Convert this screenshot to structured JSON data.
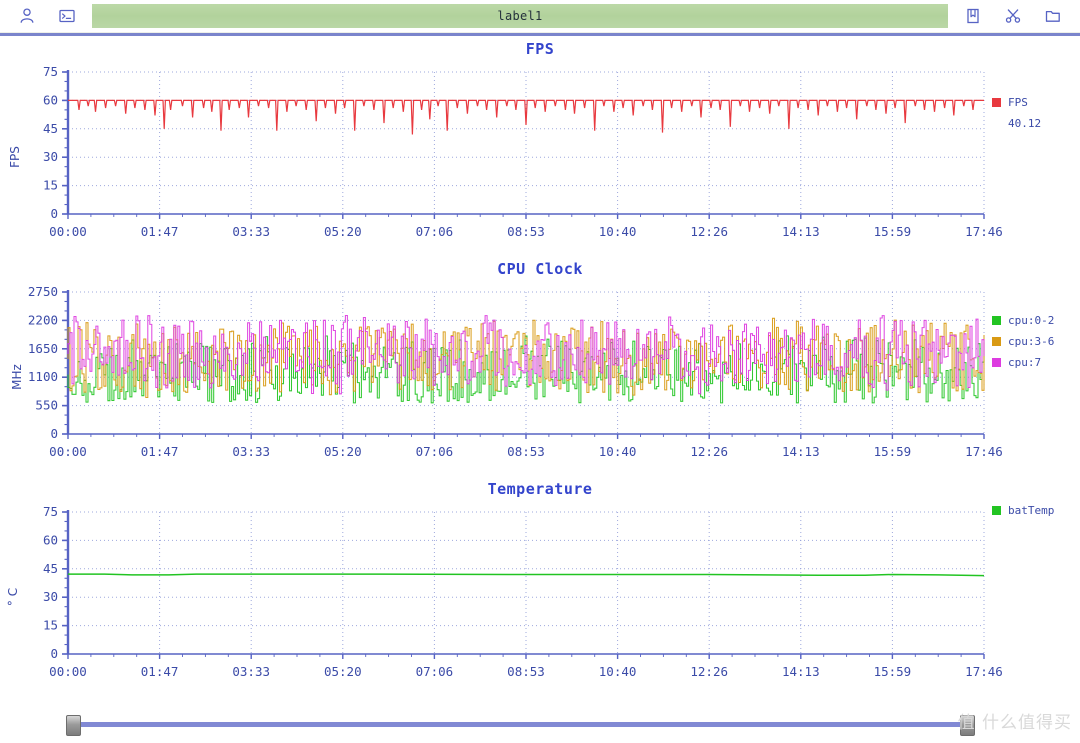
{
  "toolbar": {
    "left_icons": [
      {
        "name": "user-icon",
        "label": "user"
      },
      {
        "name": "terminal-icon",
        "label": "terminal"
      }
    ],
    "label_text": "label1",
    "label_placeholder": "label1",
    "right_icons": [
      {
        "name": "bookmark-icon",
        "label": "bookmark"
      },
      {
        "name": "scissors-icon",
        "label": "cut"
      },
      {
        "name": "folder-icon",
        "label": "open"
      }
    ],
    "bar_color": "#b2d29c",
    "separator_color": "#7b85cc"
  },
  "colors": {
    "fps": "#e8393f",
    "cpu0_2": "#22c422",
    "cpu3_6": "#d99a14",
    "cpu7": "#dd3ce0",
    "batTemp": "#22c422",
    "axis": "#3b4ba8",
    "grid": "#8e9ad8",
    "title": "#3344cc"
  },
  "x_axis": {
    "ticks": [
      "00:00",
      "01:47",
      "03:33",
      "05:20",
      "07:06",
      "08:53",
      "10:40",
      "12:26",
      "14:13",
      "15:59",
      "17:46"
    ]
  },
  "slider": {
    "left_value": 0,
    "right_value": 100
  },
  "watermark": "值 什么值得买",
  "chart_data": [
    {
      "id": "fps",
      "type": "line",
      "title": "FPS",
      "xlabel": "",
      "ylabel": "FPS",
      "ylim": [
        0,
        75
      ],
      "yticks": [
        0,
        15,
        30,
        45,
        60,
        75
      ],
      "xticks": [
        "00:00",
        "01:47",
        "03:33",
        "05:20",
        "07:06",
        "08:53",
        "10:40",
        "12:26",
        "14:13",
        "15:59",
        "17:46"
      ],
      "grid": true,
      "legend_position": "right",
      "series": [
        {
          "name": "FPS",
          "color": "#e8393f",
          "current_value": "40.12",
          "baseline": 60,
          "dips": [
            [
              0.012,
              55
            ],
            [
              0.022,
              57
            ],
            [
              0.03,
              54
            ],
            [
              0.041,
              56
            ],
            [
              0.052,
              57
            ],
            [
              0.063,
              53
            ],
            [
              0.073,
              56
            ],
            [
              0.084,
              55
            ],
            [
              0.095,
              52
            ],
            [
              0.105,
              45
            ],
            [
              0.112,
              55
            ],
            [
              0.125,
              57
            ],
            [
              0.136,
              51
            ],
            [
              0.148,
              56
            ],
            [
              0.157,
              54
            ],
            [
              0.167,
              44
            ],
            [
              0.176,
              55
            ],
            [
              0.187,
              56
            ],
            [
              0.197,
              51
            ],
            [
              0.208,
              57
            ],
            [
              0.219,
              56
            ],
            [
              0.228,
              44
            ],
            [
              0.239,
              54
            ],
            [
              0.249,
              57
            ],
            [
              0.26,
              55
            ],
            [
              0.271,
              49
            ],
            [
              0.281,
              56
            ],
            [
              0.292,
              53
            ],
            [
              0.302,
              56
            ],
            [
              0.313,
              44
            ],
            [
              0.323,
              57
            ],
            [
              0.334,
              55
            ],
            [
              0.345,
              48
            ],
            [
              0.355,
              56
            ],
            [
              0.366,
              54
            ],
            [
              0.376,
              42
            ],
            [
              0.386,
              55
            ],
            [
              0.395,
              50
            ],
            [
              0.404,
              57
            ],
            [
              0.414,
              44
            ],
            [
              0.425,
              56
            ],
            [
              0.436,
              53
            ],
            [
              0.447,
              57
            ],
            [
              0.457,
              55
            ],
            [
              0.468,
              51
            ],
            [
              0.479,
              57
            ],
            [
              0.489,
              55
            ],
            [
              0.5,
              47
            ],
            [
              0.51,
              56
            ],
            [
              0.521,
              54
            ],
            [
              0.532,
              57
            ],
            [
              0.543,
              55
            ],
            [
              0.553,
              53
            ],
            [
              0.564,
              56
            ],
            [
              0.575,
              44
            ],
            [
              0.585,
              57
            ],
            [
              0.596,
              54
            ],
            [
              0.606,
              56
            ],
            [
              0.617,
              52
            ],
            [
              0.628,
              57
            ],
            [
              0.638,
              55
            ],
            [
              0.649,
              43
            ],
            [
              0.659,
              56
            ],
            [
              0.67,
              54
            ],
            [
              0.681,
              57
            ],
            [
              0.691,
              51
            ],
            [
              0.702,
              56
            ],
            [
              0.712,
              55
            ],
            [
              0.723,
              46
            ],
            [
              0.734,
              57
            ],
            [
              0.744,
              54
            ],
            [
              0.755,
              56
            ],
            [
              0.766,
              53
            ],
            [
              0.776,
              57
            ],
            [
              0.787,
              45
            ],
            [
              0.797,
              56
            ],
            [
              0.808,
              55
            ],
            [
              0.819,
              52
            ],
            [
              0.829,
              57
            ],
            [
              0.84,
              54
            ],
            [
              0.85,
              56
            ],
            [
              0.861,
              50
            ],
            [
              0.872,
              57
            ],
            [
              0.882,
              55
            ],
            [
              0.893,
              53
            ],
            [
              0.903,
              56
            ],
            [
              0.914,
              48
            ],
            [
              0.925,
              57
            ],
            [
              0.935,
              55
            ],
            [
              0.946,
              54
            ],
            [
              0.957,
              56
            ],
            [
              0.967,
              52
            ],
            [
              0.978,
              57
            ],
            [
              0.988,
              55
            ]
          ]
        }
      ]
    },
    {
      "id": "cpu_clock",
      "type": "line",
      "title": "CPU Clock",
      "xlabel": "",
      "ylabel": "MHz",
      "ylim": [
        0,
        2750
      ],
      "yticks": [
        0,
        550,
        1100,
        1650,
        2200,
        2750
      ],
      "xticks": [
        "00:00",
        "01:47",
        "03:33",
        "05:20",
        "07:06",
        "08:53",
        "10:40",
        "12:26",
        "14:13",
        "15:59",
        "17:46"
      ],
      "grid": true,
      "legend_position": "right",
      "noise": {
        "description": "dense high-frequency oscillation between roughly 550 and 2300 MHz",
        "min": 550,
        "max": 2300,
        "mean": 1400
      },
      "series": [
        {
          "name": "cpu:0-2",
          "color": "#22c422",
          "range": [
            600,
            1900
          ],
          "mean": 1150
        },
        {
          "name": "cpu:3-6",
          "color": "#d99a14",
          "range": [
            700,
            2250
          ],
          "mean": 1450
        },
        {
          "name": "cpu:7",
          "color": "#dd3ce0",
          "range": [
            750,
            2300
          ],
          "mean": 1550
        }
      ]
    },
    {
      "id": "temperature",
      "type": "line",
      "title": "Temperature",
      "xlabel": "",
      "ylabel": "° C",
      "ylim": [
        0,
        75
      ],
      "yticks": [
        0,
        15,
        30,
        45,
        60,
        75
      ],
      "xticks": [
        "00:00",
        "01:47",
        "03:33",
        "05:20",
        "07:06",
        "08:53",
        "10:40",
        "12:26",
        "14:13",
        "15:59",
        "17:46"
      ],
      "grid": true,
      "legend_position": "right",
      "series": [
        {
          "name": "batTemp",
          "color": "#22c422",
          "points": [
            [
              0.0,
              42.2
            ],
            [
              0.04,
              42.2
            ],
            [
              0.07,
              41.8
            ],
            [
              0.11,
              41.8
            ],
            [
              0.14,
              42.2
            ],
            [
              0.3,
              42.2
            ],
            [
              0.5,
              42.0
            ],
            [
              0.7,
              42.0
            ],
            [
              0.82,
              41.6
            ],
            [
              0.87,
              41.6
            ],
            [
              0.9,
              42.0
            ],
            [
              0.95,
              41.8
            ],
            [
              1.0,
              41.4
            ]
          ]
        }
      ]
    }
  ]
}
